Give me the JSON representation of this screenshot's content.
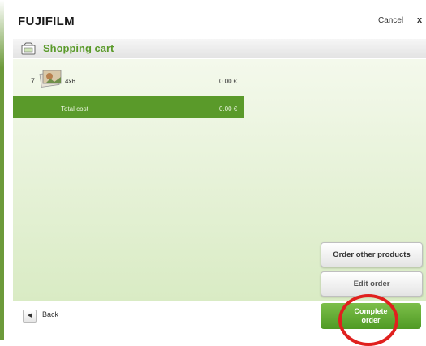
{
  "header": {
    "logo": "FUJIFILM",
    "cancel_label": "Cancel",
    "close_symbol": "x"
  },
  "titlebar": {
    "title": "Shopping cart",
    "icon": "shopping-cart-icon"
  },
  "cart": {
    "items": [
      {
        "quantity": "7",
        "size": "4x6",
        "price": "0.00 €",
        "icon": "photo-stack-icon"
      }
    ],
    "total_label": "Total cost",
    "total_price": "0.00 €"
  },
  "actions": {
    "order_other_label": "Order other products",
    "edit_order_label": "Edit order",
    "complete_order_label": "Complete\norder"
  },
  "footer": {
    "back_label": "Back",
    "back_icon": "left-arrow-icon"
  },
  "colors": {
    "brand_green": "#5a9a2a",
    "highlight_red": "#e0201e"
  }
}
